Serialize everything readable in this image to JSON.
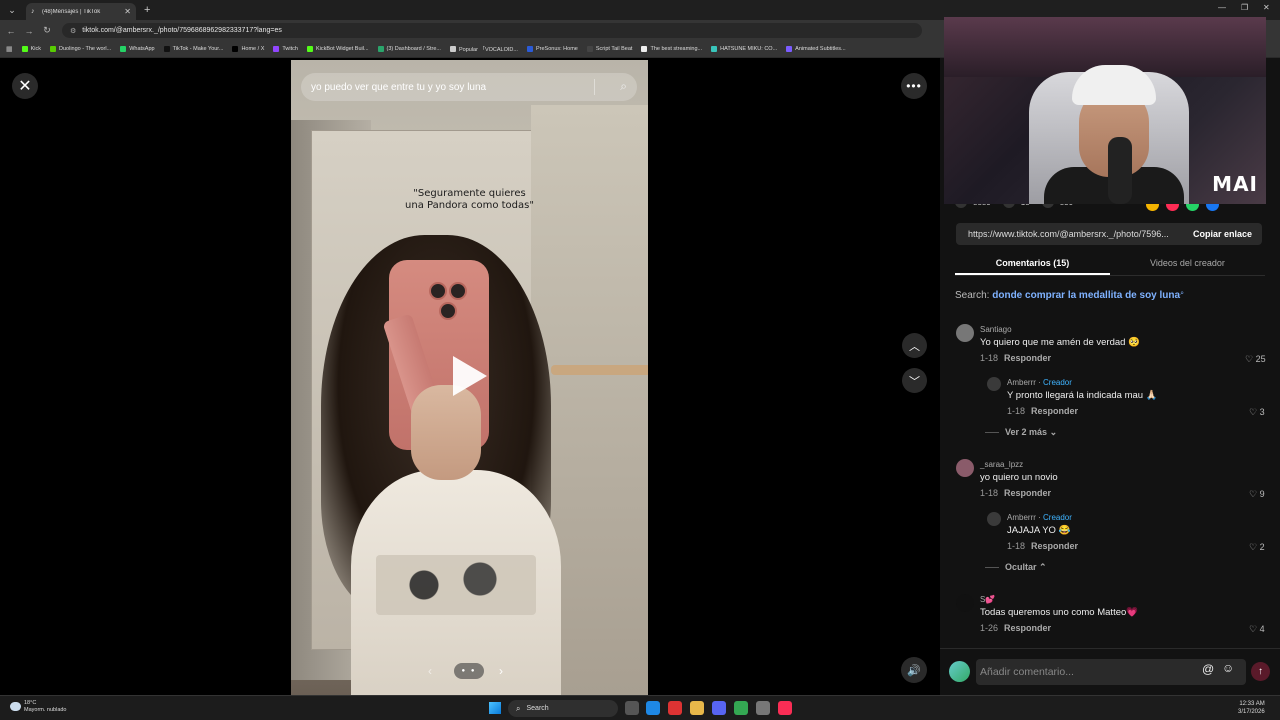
{
  "browser": {
    "tab_title": "(48)Mensajes | TikTok",
    "url": "tiktok.com/@ambersrx._/photo/7596868962982333717?lang=es",
    "bookmarks": [
      {
        "label": "Kick",
        "color": "#53fc18"
      },
      {
        "label": "Duolingo - The worl...",
        "color": "#58cc02"
      },
      {
        "label": "WhatsApp",
        "color": "#25d366"
      },
      {
        "label": "TikTok - Make Your...",
        "color": "#111111"
      },
      {
        "label": "Home / X",
        "color": "#000000"
      },
      {
        "label": "Twitch",
        "color": "#9146ff"
      },
      {
        "label": "KickBot Widget Buil...",
        "color": "#53fc18"
      },
      {
        "label": "(3) Dashboard / Stre...",
        "color": "#2aa56b"
      },
      {
        "label": "Popular 「VOCALOID...",
        "color": "#cccccc"
      },
      {
        "label": "PreSonus: Home",
        "color": "#2b5bd7"
      },
      {
        "label": "Script Tail Beat",
        "color": "#444444"
      },
      {
        "label": "The best streaming...",
        "color": "#eeeeee"
      },
      {
        "label": "HATSUNE MIKU: CO...",
        "color": "#39c5bb"
      },
      {
        "label": "Animated Subtitles...",
        "color": "#7b5cff"
      }
    ]
  },
  "viewer": {
    "search_text": "yo puedo ver que entre tu y yo soy luna",
    "photo_caption_line1": "\"Seguramente quieres",
    "photo_caption_line2": "una Pandora como todas\""
  },
  "overlay": {
    "logo_text": "MAI"
  },
  "stats": {
    "likes": "8889",
    "comments": "15",
    "saves": "830"
  },
  "share": {
    "link": "https://www.tiktok.com/@ambersrx._/photo/7596...",
    "copy_label": "Copiar enlace",
    "icon_colors": [
      "#f5b400",
      "#fe2c55",
      "#25d366",
      "#1877f2"
    ]
  },
  "tabs": {
    "comments": "Comentarios (15)",
    "creator_videos": "Videos del creador"
  },
  "search_suggestion": {
    "prefix": "Search:",
    "query": "donde comprar la medallita de soy luna"
  },
  "comments": [
    {
      "user": "Santiago",
      "text": "Yo quiero que me amén de verdad 🥺",
      "date": "1-18",
      "reply": "Responder",
      "likes": "25"
    },
    {
      "user": "Amberrr",
      "creator": "Creador",
      "text": "Y pronto llegará la indicada mau 🙏🏻",
      "date": "1-18",
      "reply": "Responder",
      "likes": "3"
    },
    {
      "more": "Ver 2 más"
    },
    {
      "user": "_saraa_lpzz",
      "text": "yo quiero un novio",
      "date": "1-18",
      "reply": "Responder",
      "likes": "9"
    },
    {
      "user": "Amberrr",
      "creator": "Creador",
      "text": "JAJAJA YO 😂",
      "date": "1-18",
      "reply": "Responder",
      "likes": "2"
    },
    {
      "more": "Ocultar"
    },
    {
      "user": "S💕",
      "text": "Todas queremos uno como Matteo💗",
      "date": "1-26",
      "reply": "Responder",
      "likes": "4"
    }
  ],
  "comment_input": {
    "placeholder": "Añadir comentario..."
  },
  "taskbar": {
    "temp": "18°C",
    "weather": "Mayorm. nublado",
    "search": "Search",
    "time": "12:33 AM",
    "date": "3/17/2026"
  }
}
